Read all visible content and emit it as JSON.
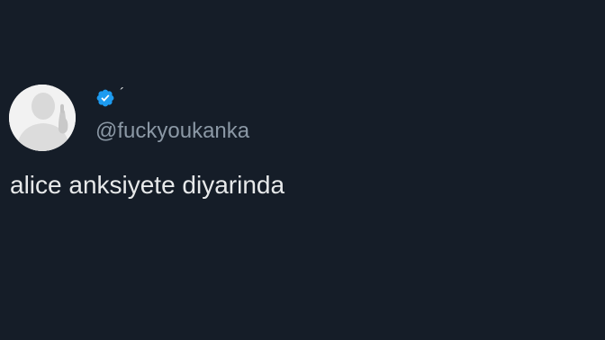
{
  "tweet": {
    "display_name": "´",
    "verified": true,
    "handle": "@fuckyoukanka",
    "text": "alice anksiyete diyarinda",
    "verified_badge_color": "#1d9bf0",
    "background_color": "#151d28"
  },
  "icons": {
    "avatar": "avatar-silhouette",
    "verified": "verified-badge-icon"
  }
}
